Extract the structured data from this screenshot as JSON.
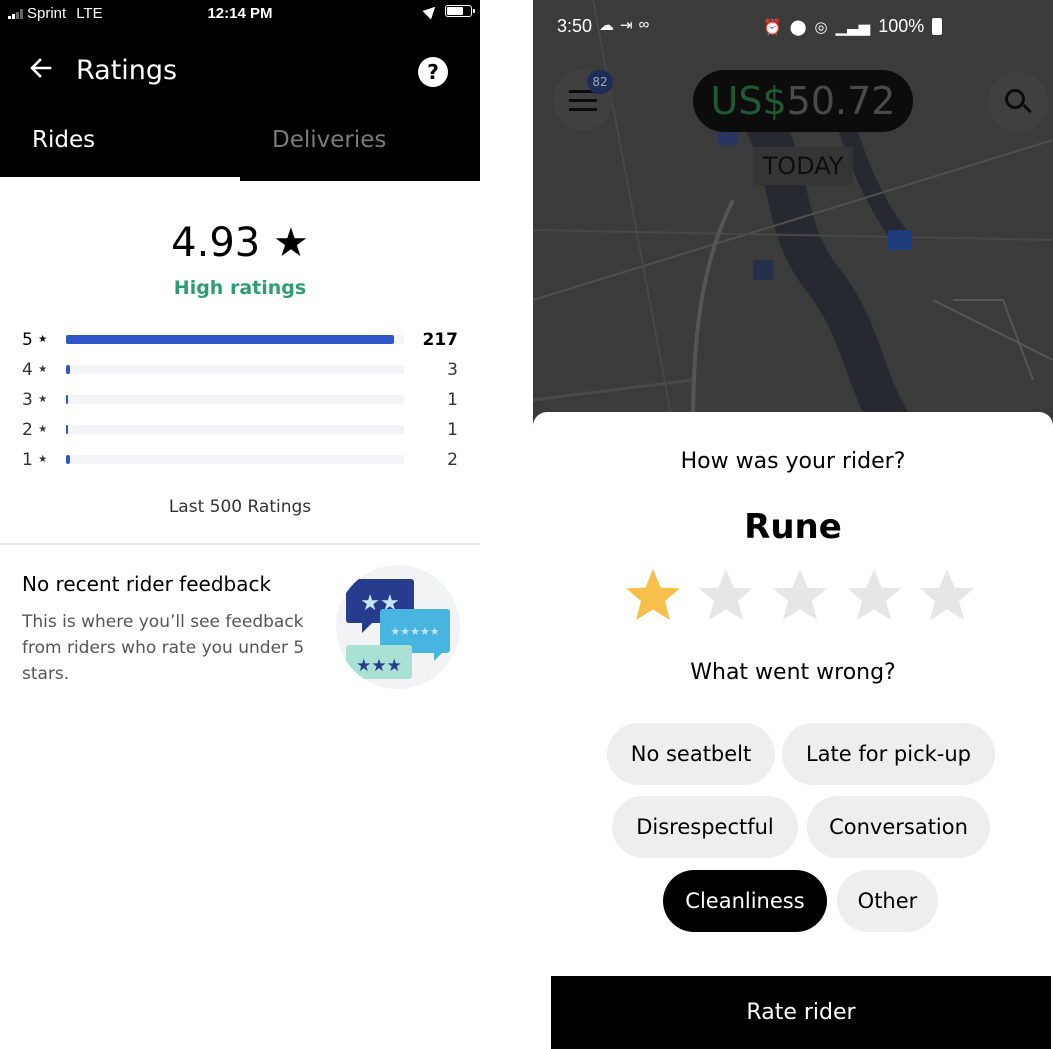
{
  "left": {
    "status_bar": {
      "carrier": "Sprint",
      "network": "LTE",
      "time": "12:14 PM"
    },
    "header": {
      "back_icon": "arrow-left-icon",
      "title": "Ratings",
      "help_icon": "question-icon",
      "help_label": "?"
    },
    "tabs": [
      {
        "label": "Rides",
        "active": true
      },
      {
        "label": "Deliveries",
        "active": false
      }
    ],
    "score": "4.93 ★",
    "score_label": "High ratings",
    "rating_rows": [
      {
        "label": "5",
        "count": "217",
        "fraction": 0.97
      },
      {
        "label": "4",
        "count": "3",
        "fraction": 0.013
      },
      {
        "label": "3",
        "count": "1",
        "fraction": 0.005
      },
      {
        "label": "2",
        "count": "1",
        "fraction": 0.005
      },
      {
        "label": "1",
        "count": "2",
        "fraction": 0.009
      }
    ],
    "last_ratings": "Last 500 Ratings",
    "feedback": {
      "title": "No recent rider feedback",
      "description": "This is where you’ll see feedback from riders who rate you under 5 stars."
    },
    "colors": {
      "accent_blue": "#2e56c8",
      "high_green": "#2e9e6f"
    }
  },
  "right": {
    "status_bar": {
      "time": "3:50",
      "battery": "100%"
    },
    "map": {
      "earnings": {
        "currency": "US$",
        "amount": "50.72"
      },
      "period": "TODAY",
      "route_badge": "82"
    },
    "sheet": {
      "question": "How was your rider?",
      "rider_name": "Rune",
      "rating": 1,
      "max_rating": 5,
      "issue_question": "What went wrong?",
      "chips": [
        {
          "label": "No seatbelt",
          "selected": false
        },
        {
          "label": "Late for pick-up",
          "selected": false
        },
        {
          "label": "Disrespectful",
          "selected": false
        },
        {
          "label": "Conversation",
          "selected": false
        },
        {
          "label": "Cleanliness",
          "selected": true
        },
        {
          "label": "Other",
          "selected": false
        }
      ],
      "submit_label": "Rate rider"
    },
    "colors": {
      "star_selected": "#f6c04a",
      "star_empty": "#e6e6e6"
    }
  }
}
